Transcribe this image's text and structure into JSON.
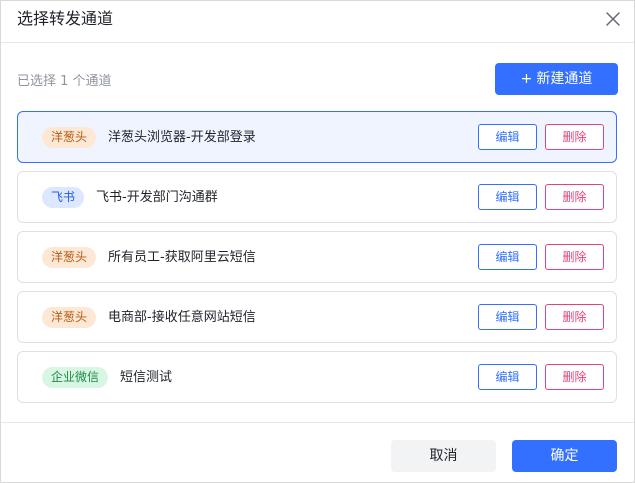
{
  "dialog": {
    "title": "选择转发通道",
    "close_icon": "close-icon"
  },
  "toolbar": {
    "selected_count": "已选择 1 个通道",
    "new_button": {
      "icon": "+",
      "label": "新建通道"
    }
  },
  "channels": [
    {
      "tag": "洋葱头",
      "tag_color": "#b75b13",
      "name": "洋葱头浏览器-开发部登录",
      "selected": true,
      "edit_label": "编辑",
      "delete_label": "删除"
    },
    {
      "tag": "飞书",
      "tag_color": "#245bdb",
      "name": "飞书-开发部门沟通群",
      "selected": false,
      "edit_label": "编辑",
      "delete_label": "删除"
    },
    {
      "tag": "洋葱头",
      "tag_color": "#b75b13",
      "name": "所有员工-获取阿里云短信",
      "selected": false,
      "edit_label": "编辑",
      "delete_label": "删除"
    },
    {
      "tag": "洋葱头",
      "tag_color": "#b75b13",
      "name": "电商部-接收任意网站短信",
      "selected": false,
      "edit_label": "编辑",
      "delete_label": "删除"
    },
    {
      "tag": "企业微信",
      "tag_color": "#1e8a4a",
      "name": "短信测试",
      "selected": false,
      "edit_label": "编辑",
      "delete_label": "删除"
    }
  ],
  "footer": {
    "cancel_label": "取消",
    "confirm_label": "确定"
  },
  "colors": {
    "primary": "#3370ff",
    "danger": "#e0457a",
    "selected_bg": "#f0f4ff"
  }
}
